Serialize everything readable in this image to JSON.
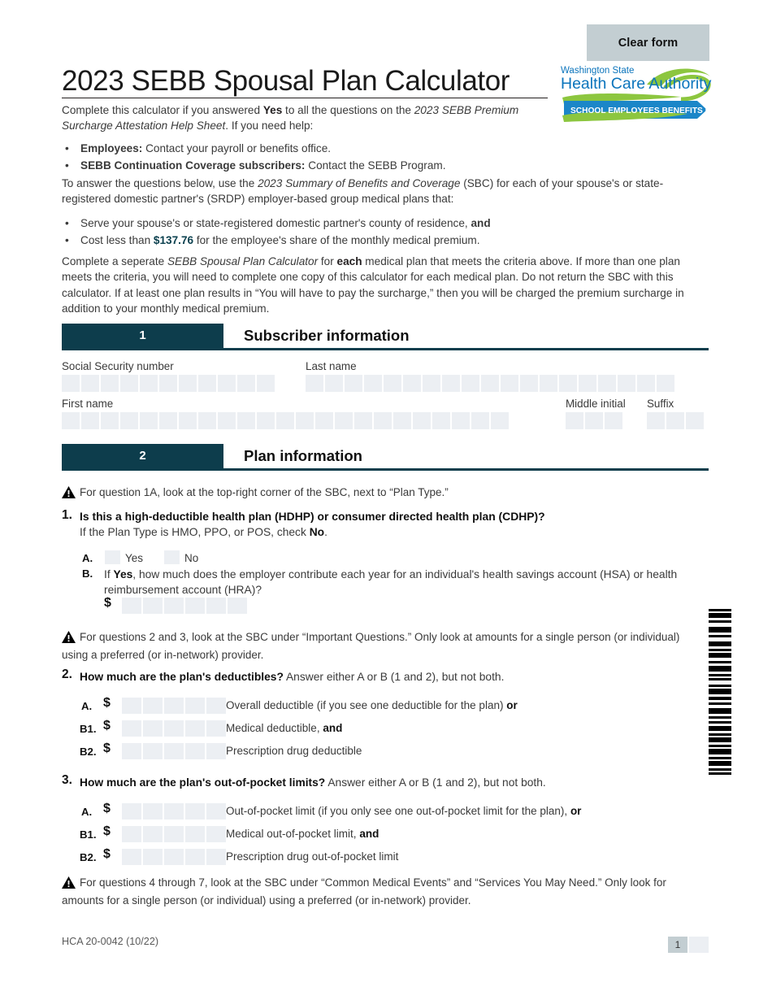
{
  "document": {
    "title": "2023 SEBB Spousal Plan Calculator",
    "clear_form_label": "Clear form",
    "footer_code": "HCA 20-0042 (10/22)",
    "page_number": "1"
  },
  "logo": {
    "line1": "Washington State",
    "line2": "Health Care Authority",
    "banner": "SCHOOL EMPLOYEES BENEFITS BOARD",
    "blue": "#0b74bc",
    "green": "#8cc63f"
  },
  "colors": {
    "section_bar": "#0d3d4c",
    "field_fill": "#eceff3",
    "clear_button": "#c3ced2",
    "teal_accent": "#0d4250"
  },
  "intro": {
    "p1_a": "Complete this calculator if you answered ",
    "p1_yes": "Yes",
    "p1_b": " to all the questions on the ",
    "p1_italic": "2023 SEBB Premium Surcharge Attestation Help Sheet",
    "p1_c": ". If you need help:",
    "bullet1_bold": "Employees:",
    "bullet1_rest": " Contact your payroll or benefits office.",
    "bullet2_bold": "SEBB Continuation Coverage subscribers:",
    "bullet2_rest": " Contact the SEBB Program.",
    "p2_a": "To answer the questions below, use the ",
    "p2_italic": "2023 Summary of Benefits and Coverage",
    "p2_b": " (SBC) for each of your spouse's or state-registered domestic partner's (SRDP) employer-based group medical plans that:",
    "bullet3_a": "Serve your spouse's or state-registered domestic partner's county of residence, ",
    "bullet3_bold": "and",
    "bullet4_a": "Cost less than ",
    "bullet4_amount": "$137.76",
    "bullet4_b": " for the employee's share of the monthly medical premium.",
    "p3_a": "Complete a seperate ",
    "p3_italic": "SEBB Spousal Plan Calculator",
    "p3_b": " for ",
    "p3_each": "each",
    "p3_c": " medical plan that meets the criteria above. If more than one plan meets the criteria, you will need to complete one copy of this calculator for each medical plan. Do not return the SBC with this calculator. If at least one plan results in “You will have to pay the surcharge,” then you will be charged the premium surcharge in addition to your monthly medical premium."
  },
  "section1": {
    "number": "1",
    "title": "Subscriber information",
    "fields": [
      {
        "label": "Social Security number",
        "cells": 11
      },
      {
        "label": "Last name",
        "cells": 19
      },
      {
        "label": "First name",
        "cells": 23
      },
      {
        "label": "Middle initial",
        "cells": 3
      },
      {
        "label": "Suffix",
        "cells": 3
      }
    ]
  },
  "section2": {
    "number": "2",
    "title": "Plan information",
    "warning1": "For question 1A, look at the top-right corner of the SBC, next to “Plan Type.”",
    "q1": {
      "num": "1.",
      "heading": "Is this a high-deductible health plan (HDHP) or consumer directed health plan (CDHP)?",
      "sub_a": "If the Plan Type is HMO, PPO, or POS, check ",
      "sub_a_bold": "No",
      "sub_a_end": ".",
      "a_letter": "A.",
      "yes_label": "Yes",
      "no_label": "No",
      "b_letter": "B.",
      "b_text_a": "If ",
      "b_text_yes": "Yes",
      "b_text_b": ", how much does the employer contribute each year for an individual's health savings account (HSA) or health reimbursement account (HRA)?",
      "dollar": "$",
      "cells": 6
    },
    "warning2": "For questions 2 and 3, look at the SBC under “Important Questions.” Only look at amounts for a single person (or individual) using a preferred (or in-network) provider.",
    "q2": {
      "num": "2.",
      "heading": "How much are the plan's deductibles?",
      "heading_rest": " Answer either A or B (1 and 2), but not both.",
      "dollar": "$",
      "cells": 5,
      "rows": [
        {
          "letter": "A.",
          "desc_a": "Overall deductible (if you see one deductible for the plan) ",
          "desc_bold": "or",
          "desc_b": ""
        },
        {
          "letter": "B1.",
          "desc_a": "Medical deductible, ",
          "desc_bold": "and",
          "desc_b": ""
        },
        {
          "letter": "B2.",
          "desc_a": "Prescription drug deductible",
          "desc_bold": "",
          "desc_b": ""
        }
      ]
    },
    "q3": {
      "num": "3.",
      "heading": "How much are the plan's out-of-pocket limits?",
      "heading_rest": " Answer either A or B (1 and 2), but not both.",
      "dollar": "$",
      "cells": 5,
      "rows": [
        {
          "letter": "A.",
          "desc_a": "Out-of-pocket limit (if you only see one out-of-pocket limit for the plan), ",
          "desc_bold": "or",
          "desc_b": ""
        },
        {
          "letter": "B1.",
          "desc_a": "Medical out-of-pocket limit, ",
          "desc_bold": "and",
          "desc_b": ""
        },
        {
          "letter": "B2.",
          "desc_a": "Prescription drug out-of-pocket limit",
          "desc_bold": "",
          "desc_b": ""
        }
      ]
    },
    "warning3": "For questions 4 through 7, look at the SBC under “Common Medical Events” and “Services You May Need.” Only look for amounts for a single person (or individual) using a preferred (or in-network) provider."
  }
}
